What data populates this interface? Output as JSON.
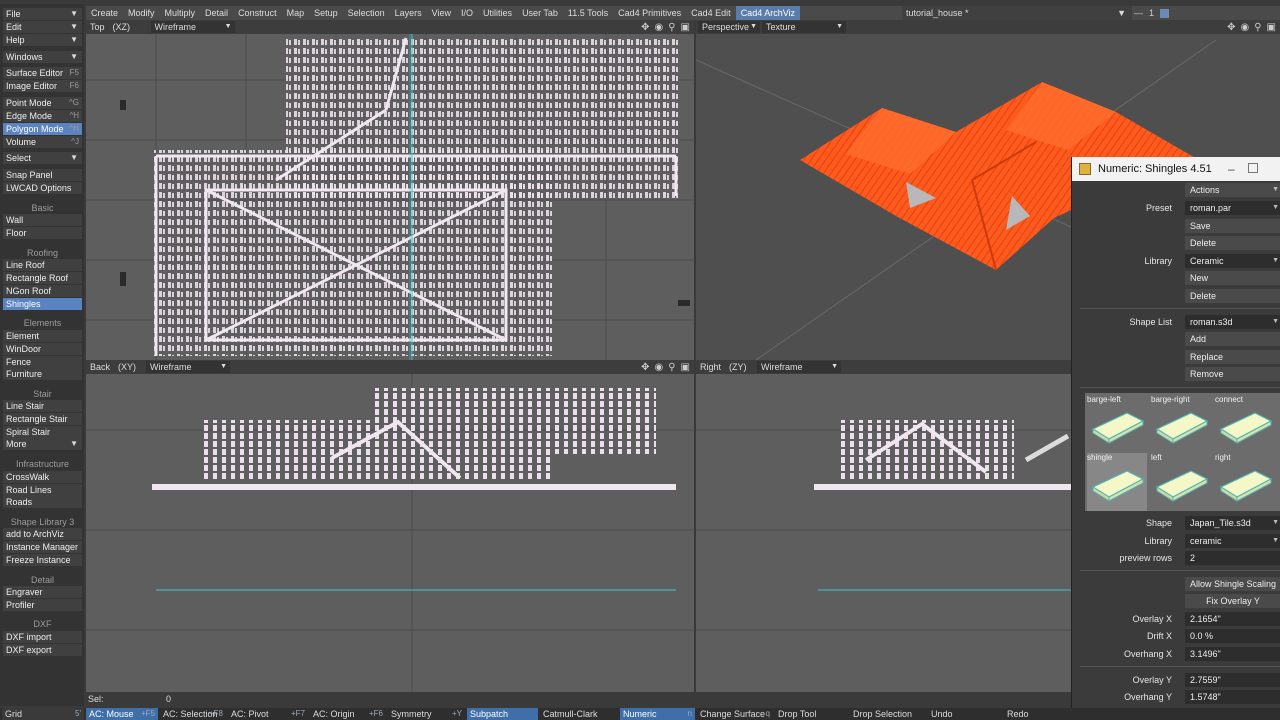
{
  "top_menu": {
    "tabs": [
      {
        "label": "Create",
        "active": false
      },
      {
        "label": "Modify",
        "active": false
      },
      {
        "label": "Multiply",
        "active": false
      },
      {
        "label": "Detail",
        "active": false
      },
      {
        "label": "Construct",
        "active": false
      },
      {
        "label": "Map",
        "active": false
      },
      {
        "label": "Setup",
        "active": false
      },
      {
        "label": "Selection",
        "active": false
      },
      {
        "label": "Layers",
        "active": false
      },
      {
        "label": "View",
        "active": false
      },
      {
        "label": "I/O",
        "active": false
      },
      {
        "label": "Utilities",
        "active": false
      },
      {
        "label": "User Tab",
        "active": false
      },
      {
        "label": "11.5 Tools",
        "active": false
      },
      {
        "label": "Cad4 Primitives",
        "active": false
      },
      {
        "label": "Cad4 Edit",
        "active": false
      },
      {
        "label": "Cad4 ArchViz",
        "active": true
      }
    ],
    "document_title": "tutorial_house *",
    "layer_number": "1"
  },
  "sidebar": {
    "items": [
      {
        "kind": "button",
        "label": "File",
        "dropdown": true
      },
      {
        "kind": "button",
        "label": "Edit",
        "dropdown": true
      },
      {
        "kind": "button",
        "label": "Help",
        "dropdown": true
      },
      {
        "kind": "button",
        "label": "Windows",
        "dropdown": true
      },
      {
        "kind": "button",
        "label": "Surface Editor",
        "shortcut": "F5"
      },
      {
        "kind": "button",
        "label": "Image Editor",
        "shortcut": "F6"
      },
      {
        "kind": "button",
        "label": "Point Mode",
        "shortcut": "^G"
      },
      {
        "kind": "button",
        "label": "Edge Mode",
        "shortcut": "^H"
      },
      {
        "kind": "button",
        "label": "Polygon Mode",
        "shortcut": "^H",
        "active": true
      },
      {
        "kind": "button",
        "label": "Volume",
        "shortcut": "^J"
      },
      {
        "kind": "button",
        "label": "Select",
        "dropdown": true
      },
      {
        "kind": "button",
        "label": "Snap Panel"
      },
      {
        "kind": "button",
        "label": "LWCAD Options"
      },
      {
        "kind": "heading",
        "label": "Basic"
      },
      {
        "kind": "button",
        "label": "Wall"
      },
      {
        "kind": "button",
        "label": "Floor"
      },
      {
        "kind": "heading",
        "label": "Roofing"
      },
      {
        "kind": "button",
        "label": "Line Roof"
      },
      {
        "kind": "button",
        "label": "Rectangle Roof"
      },
      {
        "kind": "button",
        "label": "NGon Roof"
      },
      {
        "kind": "button",
        "label": "Shingles",
        "active": true
      },
      {
        "kind": "heading",
        "label": "Elements"
      },
      {
        "kind": "button",
        "label": "Element"
      },
      {
        "kind": "button",
        "label": "WinDoor"
      },
      {
        "kind": "button",
        "label": "Fence"
      },
      {
        "kind": "button",
        "label": "Furniture"
      },
      {
        "kind": "heading",
        "label": "Stair"
      },
      {
        "kind": "button",
        "label": "Line Stair"
      },
      {
        "kind": "button",
        "label": "Rectangle Stair"
      },
      {
        "kind": "button",
        "label": "Spiral Stair"
      },
      {
        "kind": "button",
        "label": "More",
        "dropdown": true
      },
      {
        "kind": "heading",
        "label": "Infrastructure"
      },
      {
        "kind": "button",
        "label": "CrossWalk"
      },
      {
        "kind": "button",
        "label": "Road Lines"
      },
      {
        "kind": "button",
        "label": "Roads"
      },
      {
        "kind": "heading",
        "label": "Shape Library 3"
      },
      {
        "kind": "button",
        "label": "add to ArchViz"
      },
      {
        "kind": "button",
        "label": "Instance Manager"
      },
      {
        "kind": "button",
        "label": "Freeze Instance"
      },
      {
        "kind": "heading",
        "label": "Detail"
      },
      {
        "kind": "button",
        "label": "Engraver"
      },
      {
        "kind": "button",
        "label": "Profiler"
      },
      {
        "kind": "heading",
        "label": "DXF"
      },
      {
        "kind": "button",
        "label": "DXF import"
      },
      {
        "kind": "button",
        "label": "DXF export"
      }
    ]
  },
  "viewports": {
    "top": {
      "view": "Top",
      "axes": "(XZ)",
      "mode": "Wireframe"
    },
    "perspective": {
      "view": "Perspective",
      "mode": "Texture"
    },
    "back": {
      "view": "Back",
      "axes": "(XY)",
      "mode": "Wireframe"
    },
    "right": {
      "view": "Right",
      "axes": "(ZY)",
      "mode": "Wireframe"
    }
  },
  "colors": {
    "roof_texture": "#ff5a1e",
    "wire": "#e8dde8",
    "selection_active": "#5b83c0",
    "axis_line": "#38c8d0"
  },
  "panel": {
    "title": "Numeric: Shingles 4.51",
    "actions_label": "Actions",
    "preset_label": "Preset",
    "preset_value": "roman.par",
    "save_label": "Save",
    "delete_label": "Delete",
    "library_label": "Library",
    "library_value": "Ceramic",
    "new_label": "New",
    "delete2_label": "Delete",
    "shape_list_label": "Shape List",
    "shape_list_value": "roman.s3d",
    "add_label": "Add",
    "replace_label": "Replace",
    "remove_label": "Remove",
    "thumbnails": [
      {
        "label": "barge-left",
        "selected": false
      },
      {
        "label": "barge-right",
        "selected": false
      },
      {
        "label": "connect",
        "selected": false
      },
      {
        "label": "shingle",
        "selected": true
      },
      {
        "label": "left",
        "selected": false
      },
      {
        "label": "right",
        "selected": false
      }
    ],
    "shape_label": "Shape",
    "shape_value": "Japan_Tile.s3d",
    "library2_label": "Library",
    "library2_value": "ceramic",
    "preview_rows_label": "preview rows",
    "preview_rows_value": "2",
    "allow_scaling_label": "Allow Shingle Scaling",
    "fix_overlay_label": "Fix Overlay Y",
    "overlay_x_label": "Overlay X",
    "overlay_x_value": "2.1654\"",
    "drift_x_label": "Drift X",
    "drift_x_value": "0.0 %",
    "overhang_x_label": "Overhang X",
    "overhang_x_value": "3.1496\"",
    "overlay_y_label": "Overlay Y",
    "overlay_y_value": "2.7559\"",
    "overhang_y_label": "Overhang Y",
    "overhang_y_value": "1.5748\""
  },
  "selection_bar": {
    "label": "Sel:",
    "value": "0"
  },
  "status_bar": {
    "grid_label": "Grid",
    "grid_value": "5'",
    "items": [
      {
        "label": "AC: Mouse",
        "key": "+F5",
        "active": true
      },
      {
        "label": "AC: Selection",
        "key": "+F8",
        "active": false
      },
      {
        "label": "AC: Pivot",
        "key": "+F7",
        "active": false
      },
      {
        "label": "AC: Origin",
        "key": "+F6",
        "active": false
      },
      {
        "label": "Symmetry",
        "key": "+Y",
        "active": false
      },
      {
        "label": "Subpatch",
        "key": "",
        "active": true
      },
      {
        "label": "Catmull-Clark",
        "key": "",
        "active": false
      },
      {
        "label": "Numeric",
        "key": "n",
        "active": true
      },
      {
        "label": "Change Surface",
        "key": "q",
        "active": false
      },
      {
        "label": "Drop Tool",
        "key": "",
        "active": false
      },
      {
        "label": "Drop Selection",
        "key": "",
        "active": false
      },
      {
        "label": "Undo",
        "key": "",
        "active": false
      },
      {
        "label": "Redo",
        "key": "",
        "active": false
      }
    ]
  }
}
